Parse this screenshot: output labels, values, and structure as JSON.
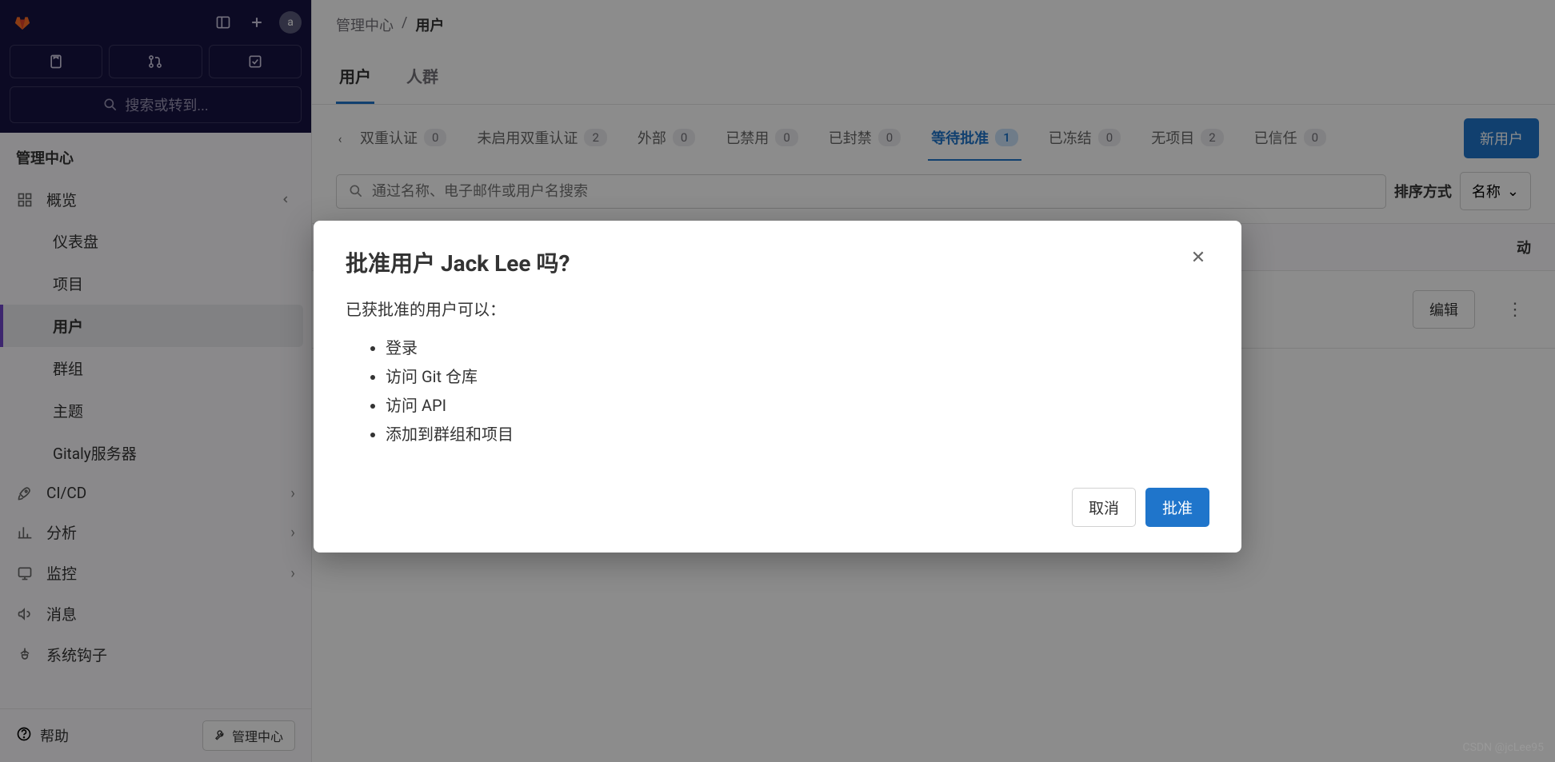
{
  "search_placeholder": "搜索或转到...",
  "sidebar_heading": "管理中心",
  "nav": {
    "overview": "概览",
    "dashboard": "仪表盘",
    "projects": "项目",
    "users": "用户",
    "groups": "群组",
    "topics": "主题",
    "gitaly": "Gitaly服务器",
    "cicd": "CI/CD",
    "analytics": "分析",
    "monitoring": "监控",
    "messages": "消息",
    "hooks": "系统钩子"
  },
  "footer": {
    "help": "帮助",
    "admin": "管理中心"
  },
  "breadcrumb": {
    "admin": "管理中心",
    "sep": "/",
    "users": "用户"
  },
  "tabs": {
    "users": "用户",
    "cohorts": "人群"
  },
  "filters": {
    "two_factor": {
      "label": "双重认证",
      "count": "0"
    },
    "no_two_factor": {
      "label": "未启用双重认证",
      "count": "2"
    },
    "external": {
      "label": "外部",
      "count": "0"
    },
    "banned": {
      "label": "已禁用",
      "count": "0"
    },
    "blocked": {
      "label": "已封禁",
      "count": "0"
    },
    "pending": {
      "label": "等待批准",
      "count": "1"
    },
    "deactivated": {
      "label": "已冻结",
      "count": "0"
    },
    "no_projects": {
      "label": "无项目",
      "count": "2"
    },
    "trusted": {
      "label": "已信任",
      "count": "0"
    }
  },
  "new_user": "新用户",
  "search_users_placeholder": "通过名称、电子邮件或用户名搜索",
  "sort": {
    "label": "排序方式",
    "value": "名称"
  },
  "table": {
    "activity": "动",
    "edit": "编辑"
  },
  "modal": {
    "title": "批准用户 Jack Lee 吗?",
    "intro": "已获批准的用户可以：",
    "items": [
      "登录",
      "访问 Git 仓库",
      "访问 API",
      "添加到群组和项目"
    ],
    "cancel": "取消",
    "approve": "批准"
  },
  "watermark": "CSDN @jcLee95",
  "avatar_letter": "a"
}
